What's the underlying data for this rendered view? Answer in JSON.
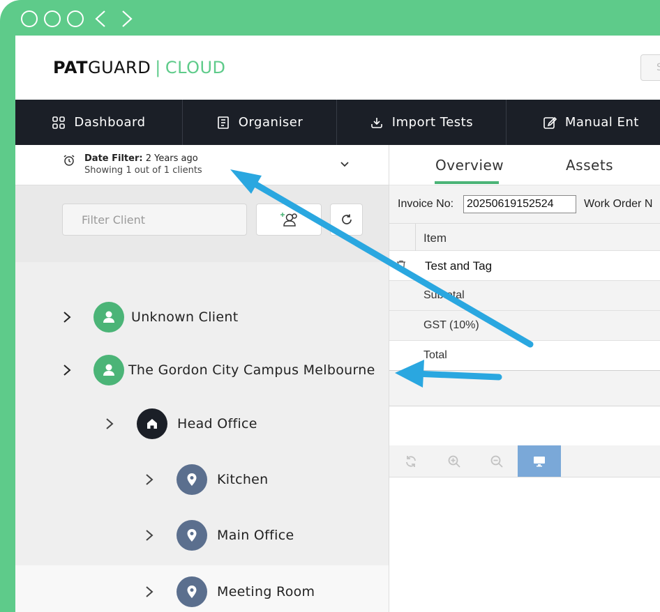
{
  "brand": {
    "part1": "PAT",
    "part2": "GUARD",
    "separator": "|",
    "part3": "CLOUD"
  },
  "header": {
    "search_stub": "S"
  },
  "nav": {
    "dashboard": "Dashboard",
    "organiser": "Organiser",
    "import_tests": "Import Tests",
    "manual_entry": "Manual Ent"
  },
  "date_filter": {
    "label": "Date Filter:",
    "value": "2 Years ago",
    "showing": "Showing 1 out of 1 clients"
  },
  "client_filter": {
    "placeholder": "Filter Client"
  },
  "tree": [
    {
      "label": "Unknown Client",
      "icon": "user-icon"
    },
    {
      "label": "The Gordon City Campus Melbourne",
      "icon": "user-icon"
    },
    {
      "label": "Head Office",
      "icon": "home-icon"
    },
    {
      "label": "Kitchen",
      "icon": "location-pin-icon"
    },
    {
      "label": "Main Office",
      "icon": "location-pin-icon"
    },
    {
      "label": "Meeting Room",
      "icon": "location-pin-icon"
    }
  ],
  "tabs": {
    "overview": "Overview",
    "assets": "Assets"
  },
  "invoice": {
    "invoice_label": "Invoice No:",
    "invoice_value": "20250619152524",
    "work_order_label": "Work Order N"
  },
  "table": {
    "header_item": "Item",
    "row_item": "Test and Tag",
    "subtotal": "Subtotal",
    "gst": "GST (10%)",
    "total": "Total"
  },
  "colors": {
    "brand_green": "#5ecb8a",
    "nav_dark": "#1b1f27",
    "arrow_blue": "#2aa7e0",
    "active_tool": "#7aa8d8"
  }
}
